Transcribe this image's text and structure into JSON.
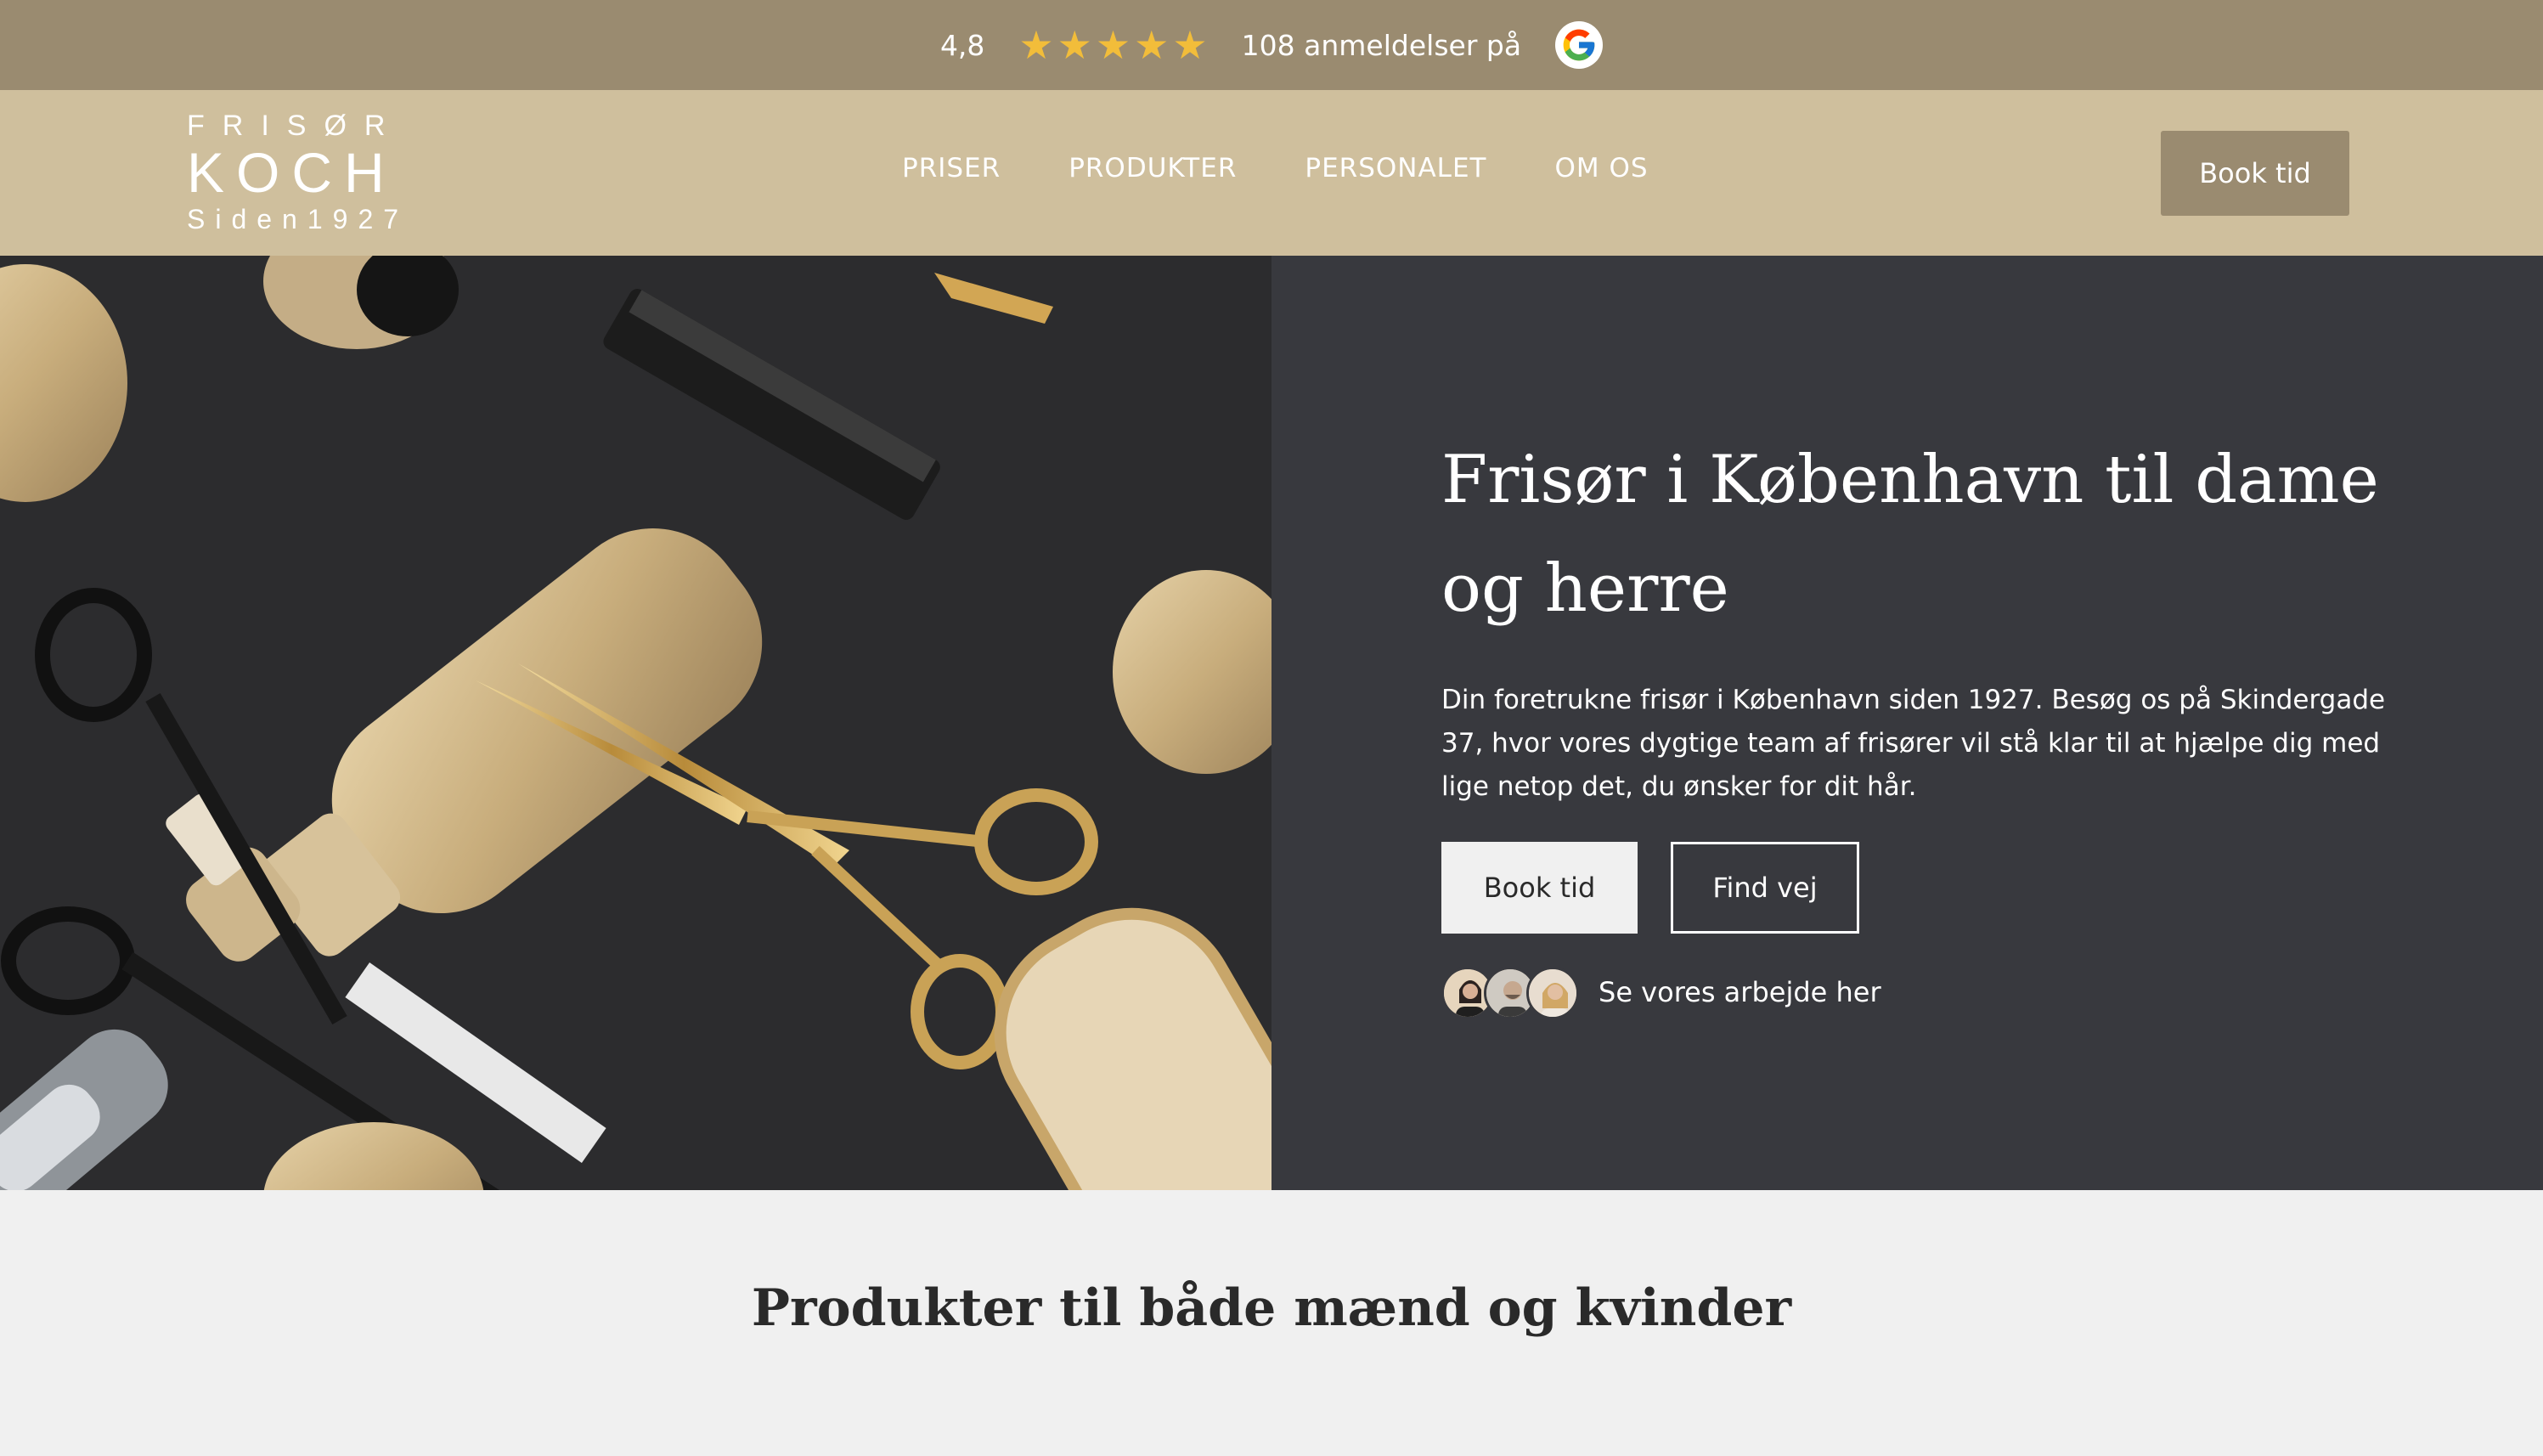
{
  "review_bar": {
    "rating": "4,8",
    "star_count": 5,
    "review_text": "108 anmeldelser på",
    "provider_icon": "google-icon",
    "star_color": "#f2bd3a",
    "background": "#9a8b70"
  },
  "header": {
    "logo": {
      "line1": "FRISØR",
      "line2": "KOCH",
      "line3": "Siden1927"
    },
    "nav": [
      {
        "label": "PRISER"
      },
      {
        "label": "PRODUKTER"
      },
      {
        "label": "PERSONALET"
      },
      {
        "label": "OM OS"
      }
    ],
    "book_label": "Book tid",
    "background": "#cfbf9d"
  },
  "hero": {
    "image_subject": "hairdressing tools on dark background",
    "title": "Frisør i København til dame og herre",
    "description": "Din foretrukne frisør i København siden 1927. Besøg os på Skindergade 37, hvor vores dygtige team af frisører vil stå klar til at hjælpe dig med lige netop det, du ønsker for dit hår.",
    "book_label": "Book tid",
    "find_label": "Find vej",
    "work_link": "Se vores arbejde her",
    "panel_color": "#38393e"
  },
  "section": {
    "title": "Produkter til både mænd og kvinder"
  }
}
